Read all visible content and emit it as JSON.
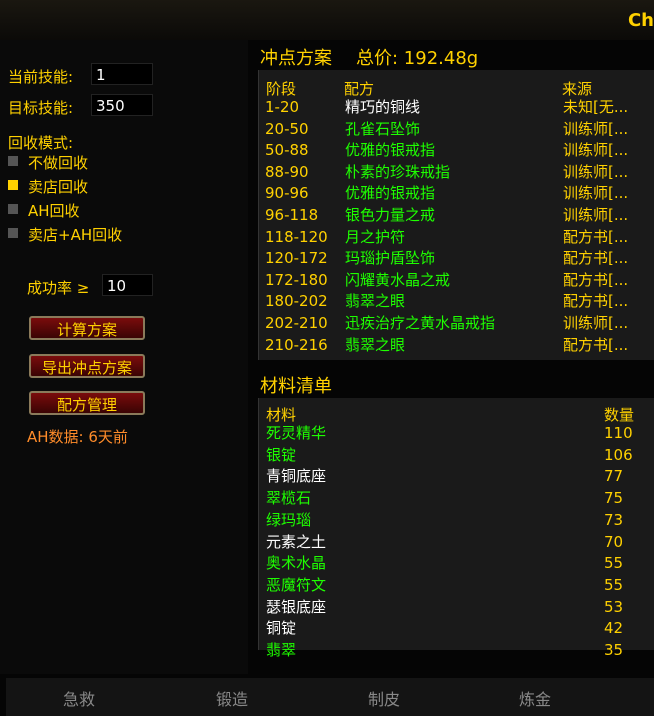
{
  "header": {
    "title": "Ch"
  },
  "left": {
    "current_skill_label": "当前技能:",
    "current_skill_value": "1",
    "target_skill_label": "目标技能:",
    "target_skill_value": "350",
    "recycle_label": "回收模式:",
    "recycle_options": [
      {
        "label": "不做回收",
        "selected": false
      },
      {
        "label": "卖店回收",
        "selected": true
      },
      {
        "label": "AH回收",
        "selected": false
      },
      {
        "label": "卖店+AH回收",
        "selected": false
      }
    ],
    "success_label": "成功率 ≥",
    "success_value": "10",
    "calc_button": "计算方案",
    "export_button": "导出冲点方案",
    "recipe_button": "配方管理",
    "ah_data": "AH数据: 6天前"
  },
  "plan": {
    "title": "冲点方案",
    "total_price": "总价: 192.48g",
    "columns": {
      "stage": "阶段",
      "recipe": "配方",
      "source": "来源"
    },
    "rows": [
      {
        "stage": "1-20",
        "recipe": "精巧的铜线",
        "source": "未知[无...",
        "color": "white"
      },
      {
        "stage": "20-50",
        "recipe": "孔雀石坠饰",
        "source": "训练师[...",
        "color": "green"
      },
      {
        "stage": "50-88",
        "recipe": "优雅的银戒指",
        "source": "训练师[...",
        "color": "green"
      },
      {
        "stage": "88-90",
        "recipe": "朴素的珍珠戒指",
        "source": "训练师[...",
        "color": "green"
      },
      {
        "stage": "90-96",
        "recipe": "优雅的银戒指",
        "source": "训练师[...",
        "color": "green"
      },
      {
        "stage": "96-118",
        "recipe": "银色力量之戒",
        "source": "训练师[...",
        "color": "green"
      },
      {
        "stage": "118-120",
        "recipe": "月之护符",
        "source": "配方书[...",
        "color": "green"
      },
      {
        "stage": "120-172",
        "recipe": "玛瑙护盾坠饰",
        "source": "配方书[...",
        "color": "green"
      },
      {
        "stage": "172-180",
        "recipe": "闪耀黄水晶之戒",
        "source": "配方书[...",
        "color": "green"
      },
      {
        "stage": "180-202",
        "recipe": "翡翠之眼",
        "source": "配方书[...",
        "color": "green"
      },
      {
        "stage": "202-210",
        "recipe": "迅疾治疗之黄水晶戒指",
        "source": "训练师[...",
        "color": "green"
      },
      {
        "stage": "210-216",
        "recipe": "翡翠之眼",
        "source": "配方书[...",
        "color": "green"
      }
    ]
  },
  "materials": {
    "title": "材料清单",
    "columns": {
      "name": "材料",
      "qty": "数量"
    },
    "rows": [
      {
        "name": "死灵精华",
        "qty": "110",
        "color": "green"
      },
      {
        "name": "银锭",
        "qty": "106",
        "color": "green"
      },
      {
        "name": "青铜底座",
        "qty": "77",
        "color": "white"
      },
      {
        "name": "翠榄石",
        "qty": "75",
        "color": "green"
      },
      {
        "name": "绿玛瑙",
        "qty": "73",
        "color": "green"
      },
      {
        "name": "元素之土",
        "qty": "70",
        "color": "white"
      },
      {
        "name": "奥术水晶",
        "qty": "55",
        "color": "green"
      },
      {
        "name": "恶魔符文",
        "qty": "55",
        "color": "green"
      },
      {
        "name": "瑟银底座",
        "qty": "53",
        "color": "white"
      },
      {
        "name": "铜锭",
        "qty": "42",
        "color": "white"
      },
      {
        "name": "翡翠",
        "qty": "35",
        "color": "green"
      }
    ]
  },
  "tabs": [
    "急救",
    "锻造",
    "制皮",
    "炼金"
  ]
}
